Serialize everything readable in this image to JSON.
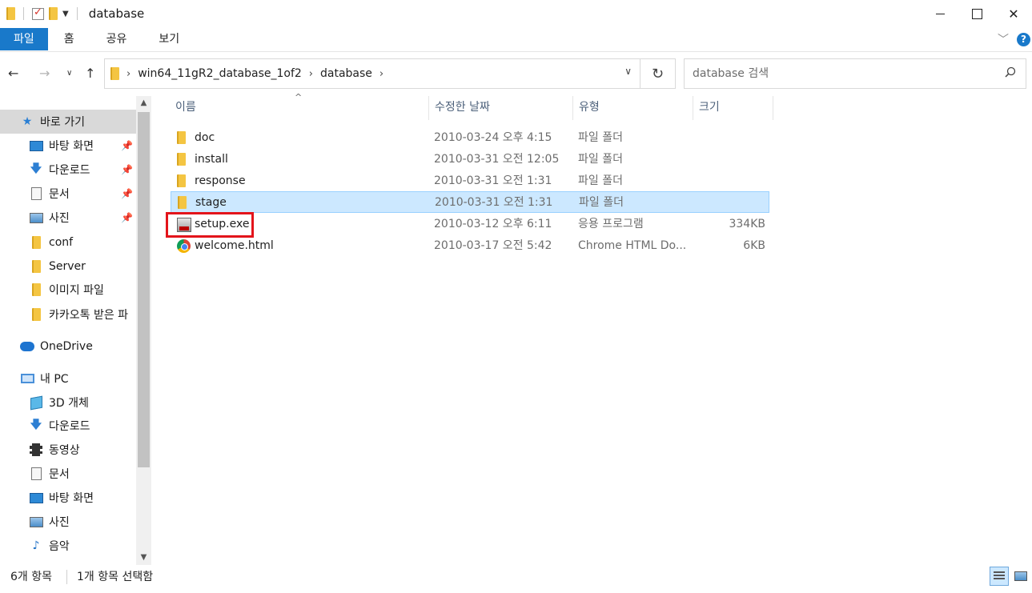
{
  "window": {
    "title": "database"
  },
  "ribbon": {
    "tabs": [
      "파일",
      "홈",
      "공유",
      "보기"
    ]
  },
  "address": {
    "crumbs": [
      "win64_11gR2_database_1of2",
      "database"
    ]
  },
  "search": {
    "placeholder": "database 검색"
  },
  "navpane": {
    "quick_access": "바로 가기",
    "pinned": [
      {
        "label": "바탕 화면",
        "icon": "desktop-icon"
      },
      {
        "label": "다운로드",
        "icon": "download-icon"
      },
      {
        "label": "문서",
        "icon": "document-icon"
      },
      {
        "label": "사진",
        "icon": "pictures-icon"
      }
    ],
    "recent": [
      "conf",
      "Server",
      "이미지 파일",
      "카카오톡 받은 파"
    ],
    "onedrive": "OneDrive",
    "this_pc": "내 PC",
    "pc_items": [
      {
        "label": "3D 개체",
        "icon": "3d-objects-icon"
      },
      {
        "label": "다운로드",
        "icon": "download-icon"
      },
      {
        "label": "동영상",
        "icon": "video-icon"
      },
      {
        "label": "문서",
        "icon": "document-icon"
      },
      {
        "label": "바탕 화면",
        "icon": "desktop-icon"
      },
      {
        "label": "사진",
        "icon": "pictures-icon"
      },
      {
        "label": "음악",
        "icon": "music-icon"
      }
    ]
  },
  "columns": {
    "name": "이름",
    "date": "수정한 날짜",
    "type": "유형",
    "size": "크기"
  },
  "files": [
    {
      "name": "doc",
      "date": "2010-03-24 오후 4:15",
      "type": "파일 폴더",
      "size": "",
      "icon": "folder-icon",
      "selected": false
    },
    {
      "name": "install",
      "date": "2010-03-31 오전 12:05",
      "type": "파일 폴더",
      "size": "",
      "icon": "folder-icon",
      "selected": false
    },
    {
      "name": "response",
      "date": "2010-03-31 오전 1:31",
      "type": "파일 폴더",
      "size": "",
      "icon": "folder-icon",
      "selected": false
    },
    {
      "name": "stage",
      "date": "2010-03-31 오전 1:31",
      "type": "파일 폴더",
      "size": "",
      "icon": "folder-icon",
      "selected": true
    },
    {
      "name": "setup.exe",
      "date": "2010-03-12 오후 6:11",
      "type": "응용 프로그램",
      "size": "334KB",
      "icon": "exe-icon",
      "selected": false
    },
    {
      "name": "welcome.html",
      "date": "2010-03-17 오전 5:42",
      "type": "Chrome HTML Do...",
      "size": "6KB",
      "icon": "chrome-icon",
      "selected": false
    }
  ],
  "status": {
    "count": "6개 항목",
    "selection": "1개 항목 선택함"
  },
  "colors": {
    "accent": "#1979ca",
    "selection_bg": "#cce8ff",
    "highlight_box": "#e3141b"
  }
}
